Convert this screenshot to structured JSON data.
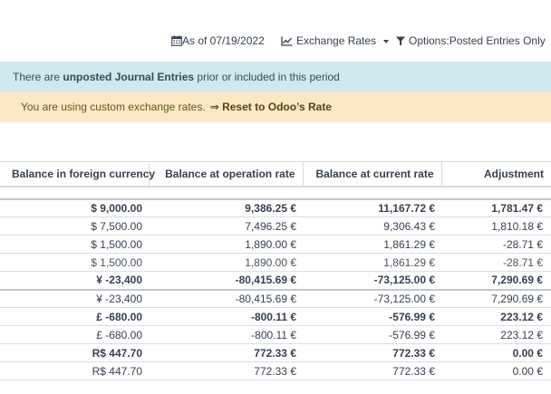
{
  "toolbar": {
    "as_of": "As of 07/19/2022",
    "exchange_rates": "Exchange Rates",
    "options": "Options:Posted Entries Only"
  },
  "alerts": {
    "info_prefix": "There are",
    "info_bold": "unposted Journal Entries",
    "info_suffix": "prior or included in this period",
    "warning_text": "You are using custom exchange rates.",
    "warning_link": "⇒ Reset to Odoo’s Rate"
  },
  "table": {
    "headers": [
      "Balance in foreign currency",
      "Balance at operation rate",
      "Balance at current rate",
      "Adjustment"
    ],
    "rows": [
      {
        "cells": [
          "$ 9,000.00",
          "9,386.25 €",
          "11,167.72 €",
          "1,781.47 €"
        ],
        "style": "bold thick"
      },
      {
        "cells": [
          "$ 7,500.00",
          "7,496.25 €",
          "9,306.43 €",
          "1,810.18 €"
        ],
        "style": ""
      },
      {
        "cells": [
          "$ 1,500.00",
          "1,890.00 €",
          "1,861.29 €",
          "-28.71 €"
        ],
        "style": ""
      },
      {
        "cells": [
          "$ 1,500.00",
          "1,890.00 €",
          "1,861.29 €",
          "-28.71 €"
        ],
        "style": "light"
      },
      {
        "cells": [
          "¥ -23,400",
          "-80,415.69 €",
          "-73,125.00 €",
          "7,290.69 €"
        ],
        "style": "bold"
      },
      {
        "cells": [
          "¥ -23,400",
          "-80,415.69 €",
          "-73,125.00 €",
          "7,290.69 €"
        ],
        "style": "thick"
      },
      {
        "cells": [
          "£ -680.00",
          "-800.11 €",
          "-576.99 €",
          "223.12 €"
        ],
        "style": "bold"
      },
      {
        "cells": [
          "£ -680.00",
          "-800.11 €",
          "-576.99 €",
          "223.12 €"
        ],
        "style": ""
      },
      {
        "cells": [
          "R$ 447.70",
          "772.33 €",
          "772.33 €",
          "0.00 €"
        ],
        "style": "bold"
      },
      {
        "cells": [
          "R$ 447.70",
          "772.33 €",
          "772.33 €",
          "0.00 €"
        ],
        "style": "last"
      }
    ]
  },
  "icons": {
    "as_of": "calendar-icon",
    "exchange_rates": "line-chart-icon",
    "options": "filter-icon"
  }
}
